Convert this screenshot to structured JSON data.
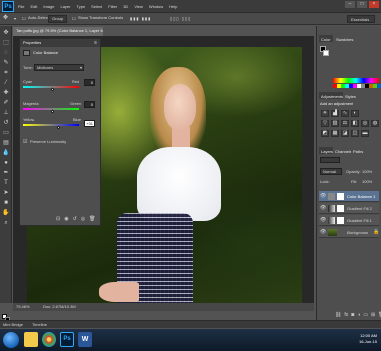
{
  "app": {
    "logo": "Ps",
    "menus": [
      "File",
      "Edit",
      "Image",
      "Layer",
      "Type",
      "Select",
      "Filter",
      "3D",
      "View",
      "Window",
      "Help"
    ]
  },
  "options_bar": {
    "auto_select_label": "Auto-Select:",
    "auto_select_value": "Group",
    "show_transform_label": "Show Transform Controls",
    "workspace": "Essentials"
  },
  "document": {
    "tab_title": "Tan puffs.jpg @ 79.5% (Color Balance 1, Layer Mask/8)",
    "zoom": "79.46%",
    "doc_info": "Doc: 2.67M/10.3M"
  },
  "properties": {
    "title": "Properties",
    "panel_name": "Color Balance",
    "tone_label": "Tone:",
    "tone_value": "Midtones",
    "sliders": [
      {
        "left": "Cyan",
        "right": "Red",
        "value": "0",
        "position": 0.5
      },
      {
        "left": "Magenta",
        "right": "Green",
        "value": "0",
        "position": 0.5
      },
      {
        "left": "Yellow",
        "right": "Blue",
        "value": "+31",
        "position": 0.62
      }
    ],
    "preserve_luminosity": "Preserve Luminosity"
  },
  "right_panels": {
    "color_tab": "Color",
    "swatches_tab": "Swatches",
    "adjustments_tab": "Adjustments",
    "styles_tab": "Styles",
    "add_adjustment": "Add an adjustment",
    "layers_tab": "Layers",
    "channels_tab": "Channels",
    "paths_tab": "Paths",
    "blend_mode": "Normal",
    "opacity_label": "Opacity:",
    "opacity_value": "100%",
    "lock_label": "Lock:",
    "fill_label": "Fill:",
    "fill_value": "100%",
    "layers": [
      {
        "name": "Color Balance 1",
        "selected": true
      },
      {
        "name": "Gradient Fill 2",
        "selected": false
      },
      {
        "name": "Gradient Fill 1",
        "selected": false
      },
      {
        "name": "Background",
        "selected": false
      }
    ],
    "swatch_colors": [
      "#ff0000",
      "#ffff00",
      "#00ff00",
      "#00ffff",
      "#0000ff",
      "#ff00ff",
      "#ffffff",
      "#888888",
      "#000000",
      "#c86400",
      "#64c800",
      "#0064c8"
    ]
  },
  "bottom": {
    "mini_bridge": "Mini Bridge",
    "timeline": "Timeline"
  },
  "taskbar": {
    "time": "12:00 AM",
    "date": "16-Jun-15"
  }
}
